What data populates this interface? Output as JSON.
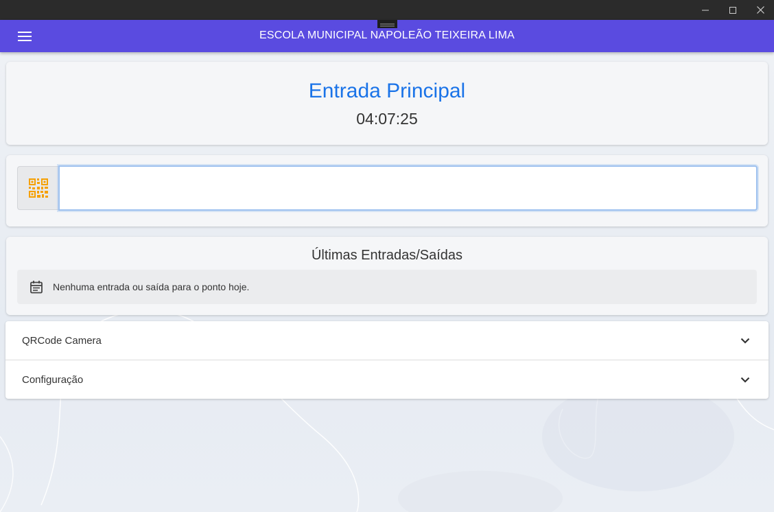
{
  "window": {
    "controls": {
      "minimize_icon": "minimize-icon",
      "maximize_icon": "maximize-icon",
      "close_icon": "close-icon"
    }
  },
  "appbar": {
    "title": "ESCOLA MUNICIPAL NAPOLEÃO TEIXEIRA LIMA",
    "menu_icon": "hamburger-menu-icon",
    "color": "#5a4be0"
  },
  "header_card": {
    "title": "Entrada Principal",
    "clock": "04:07:25",
    "title_color": "#1a73e8"
  },
  "scanner": {
    "addon_icon": "qrcode-icon",
    "icon_color": "#f5a000",
    "input_value": ""
  },
  "log": {
    "title": "Últimas Entradas/Saídas",
    "empty_icon": "calendar-icon",
    "empty_message": "Nenhuma entrada ou saída para o ponto hoje."
  },
  "accordion": {
    "items": [
      {
        "label": "QRCode Camera",
        "icon": "chevron-down-icon"
      },
      {
        "label": "Configuração",
        "icon": "chevron-down-icon"
      }
    ]
  }
}
